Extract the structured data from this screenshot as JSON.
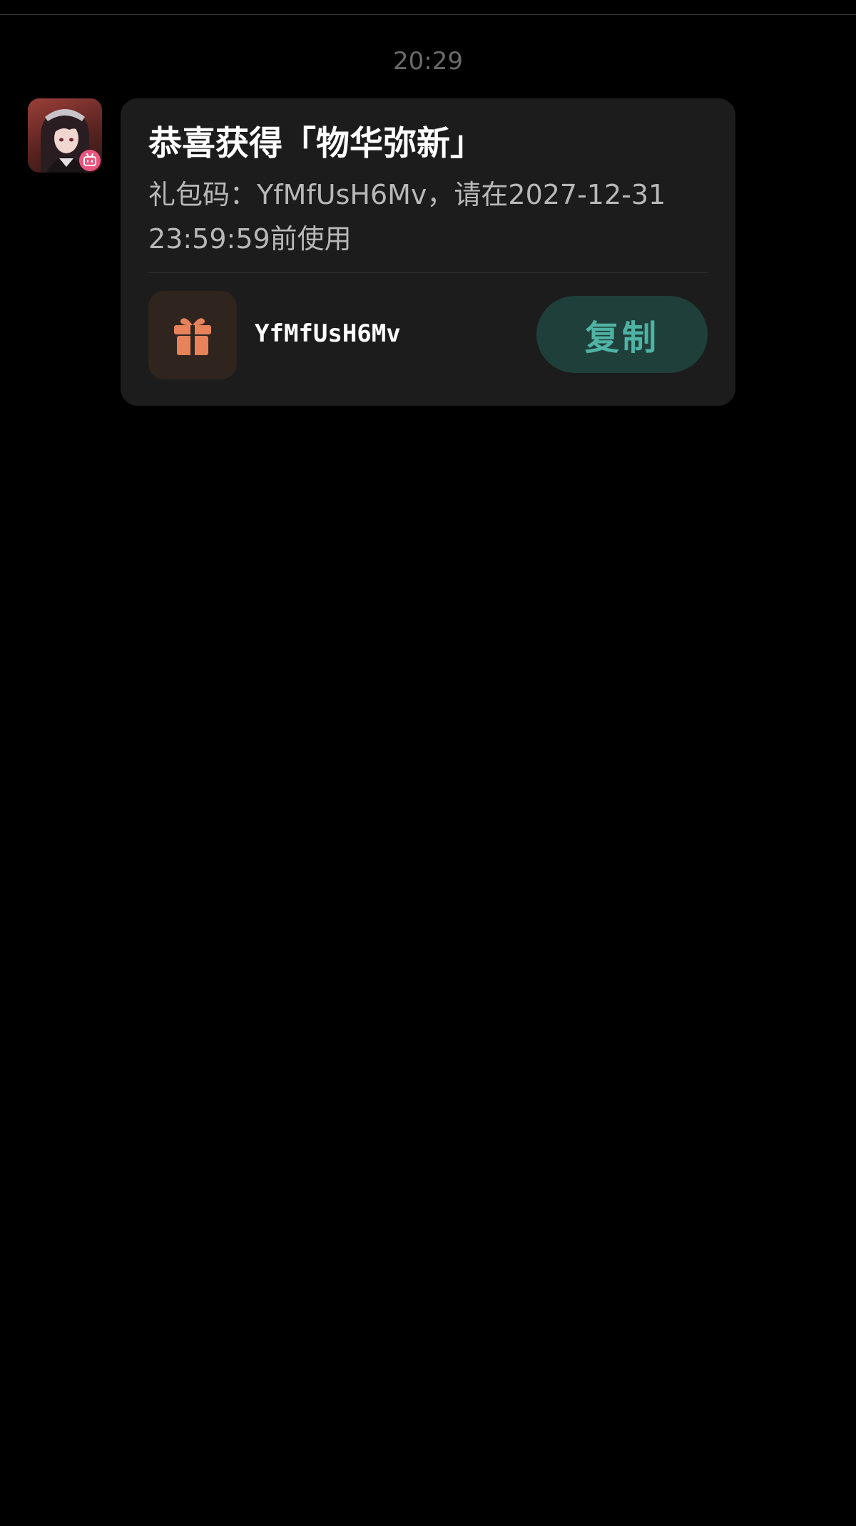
{
  "chat": {
    "timestamp": "20:29"
  },
  "message": {
    "title": "恭喜获得「物华弥新」",
    "body": "礼包码：YfMfUsH6Mv，请在2027-12-31 23:59:59前使用",
    "gift_code": "YfMfUsH6Mv",
    "copy_label": "复制"
  },
  "icons": {
    "avatar": "character-avatar",
    "avatar_badge": "bilibili-tv-icon",
    "gift": "gift-icon"
  },
  "colors": {
    "background": "#000000",
    "bubble": "#1c1c1c",
    "gift_accent": "#e8825a",
    "copy_button_bg": "#1f3f3b",
    "copy_button_text": "#4fb3a4",
    "badge": "#e8567f"
  }
}
